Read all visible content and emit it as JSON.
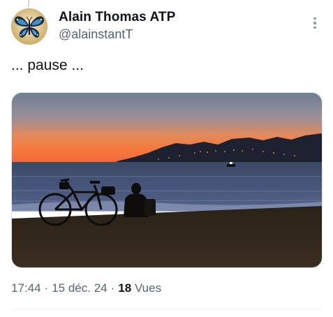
{
  "author": {
    "display_name": "Alain Thomas ATP",
    "handle": "@alainstantT",
    "avatar_icon": "butterfly-icon"
  },
  "tweet": {
    "text": "... pause ...",
    "time": "17:44",
    "date": "15 déc. 24",
    "views_count": "18",
    "views_label": "Vues",
    "separator": "·"
  },
  "media": {
    "description_icon": "photo-sunset-beach-bicycle"
  },
  "colors": {
    "primary_text": "#0f1419",
    "secondary_text": "#536471",
    "divider": "#eff3f4"
  }
}
